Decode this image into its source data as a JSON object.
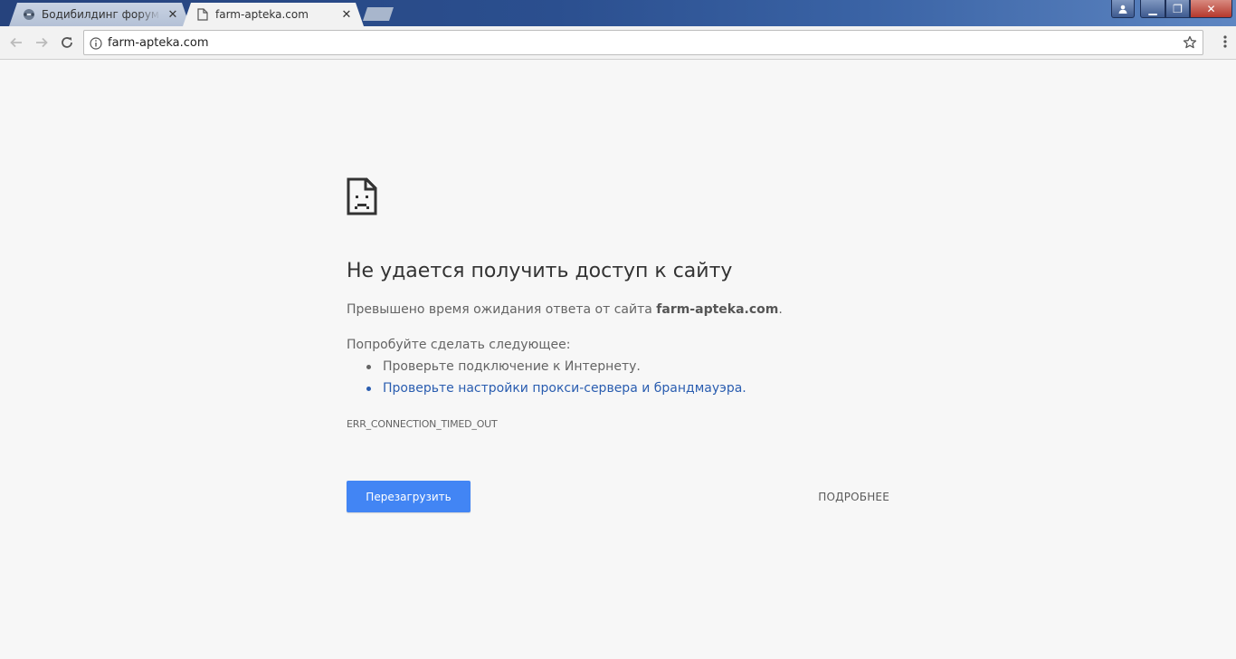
{
  "browser": {
    "tabs": [
      {
        "title": "Бодибилдинг форум Ап",
        "active": false,
        "favicon": "forum-favicon"
      },
      {
        "title": "farm-apteka.com",
        "active": true,
        "favicon": "page-icon"
      }
    ],
    "address_bar": {
      "url": "farm-apteka.com"
    },
    "window_buttons": {
      "minimize": "▁",
      "maximize": "❐",
      "close": "✕"
    }
  },
  "error_page": {
    "icon": "sad-file-icon",
    "heading": "Не удается получить доступ к сайту",
    "description_prefix": "Превышено время ожидания ответа от сайта ",
    "description_host": "farm-apteka.com",
    "description_suffix": ".",
    "suggestions_title": "Попробуйте сделать следующее:",
    "suggestions": [
      "Проверьте подключение к Интернету.",
      "Проверьте настройки прокси-сервера и брандмауэра."
    ],
    "error_code": "ERR_CONNECTION_TIMED_OUT",
    "reload_label": "Перезагрузить",
    "details_label": "ПОДРОБНЕЕ"
  },
  "colors": {
    "primary_button": "#4285f4",
    "link": "#2a5db0",
    "background": "#f7f7f7"
  }
}
